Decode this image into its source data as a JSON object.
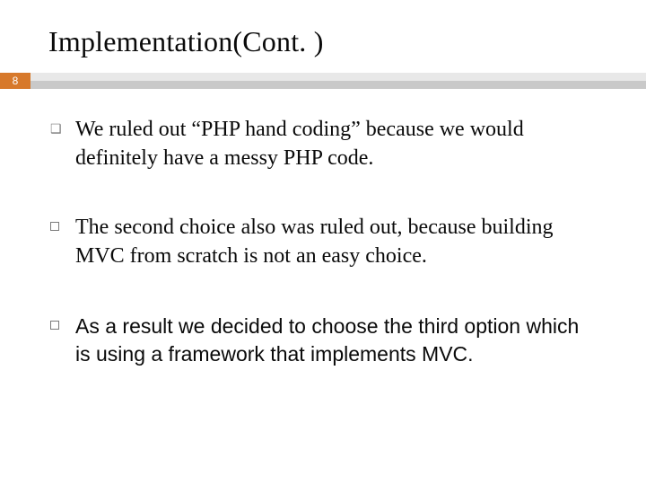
{
  "slide": {
    "title": "Implementation(Cont. )",
    "page_number": "8",
    "items": [
      {
        "bullet": "q",
        "font": "serif",
        "text": "We ruled out “PHP hand coding”  because we would  definitely have a messy PHP code."
      },
      {
        "bullet": "square",
        "font": "serif",
        "text": " The second choice also was ruled out, because building  MVC from scratch is not an easy choice."
      },
      {
        "bullet": "square",
        "font": "arial",
        "text": " As a result we decided to choose the third option which is using a framework that implements MVC."
      }
    ]
  }
}
